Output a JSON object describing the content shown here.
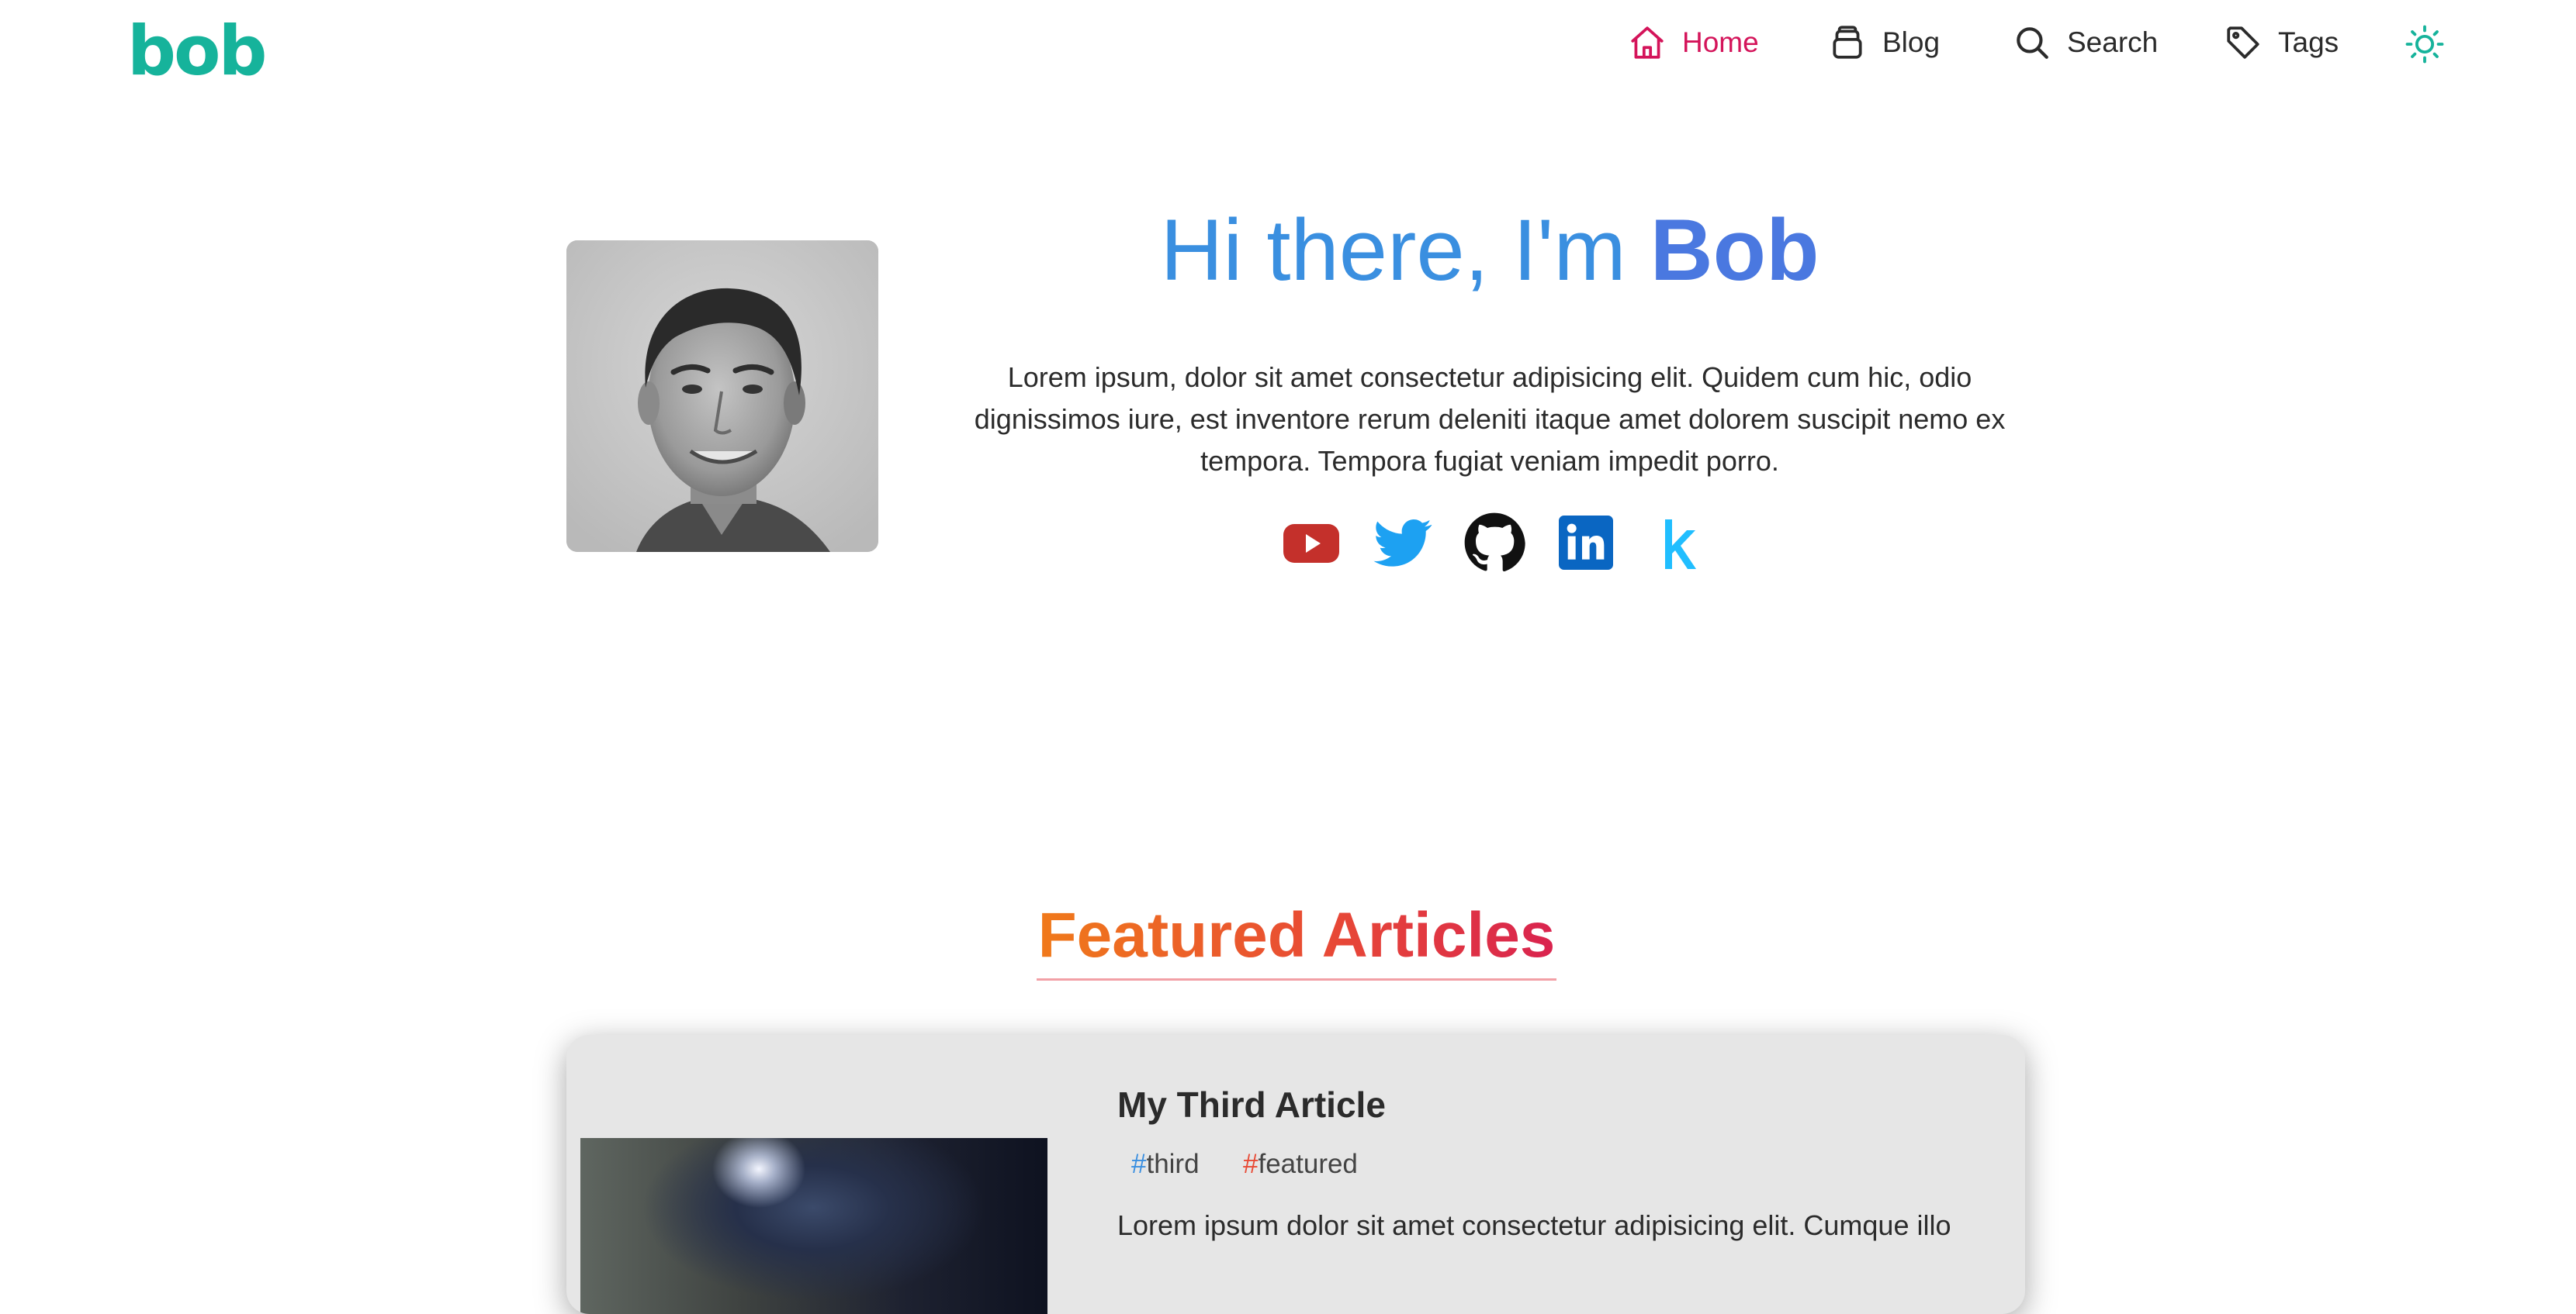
{
  "header": {
    "logo_text": "bob",
    "nav": [
      {
        "label": "Home",
        "icon": "home-icon",
        "active": true
      },
      {
        "label": "Blog",
        "icon": "blog-icon",
        "active": false
      },
      {
        "label": "Search",
        "icon": "search-icon",
        "active": false
      },
      {
        "label": "Tags",
        "icon": "tag-icon",
        "active": false
      }
    ],
    "theme_toggle_icon": "sun-icon"
  },
  "hero": {
    "greeting": "Hi there, I'm ",
    "name": "Bob",
    "bio": "Lorem ipsum, dolor sit amet consectetur adipisicing elit. Quidem cum hic, odio dignissimos iure, est inventore rerum deleniti itaque amet dolorem suscipit nemo ex tempora. Tempora fugiat veniam impedit porro.",
    "socials": [
      "youtube-icon",
      "twitter-icon",
      "github-icon",
      "linkedin-icon",
      "kaggle-icon"
    ]
  },
  "featured": {
    "heading": "Featured Articles",
    "articles": [
      {
        "title": "My Third Article",
        "tags": [
          "third",
          "featured"
        ],
        "tag_prefix": "#",
        "excerpt": "Lorem ipsum dolor sit amet consectetur adipisicing elit. Cumque illo"
      }
    ]
  },
  "colors": {
    "brand": "#16b39b",
    "active_nav": "#d4145a",
    "hero_blue": "#3a8fe0",
    "featured_orange": "#f07a1a",
    "featured_red": "#d9234f"
  }
}
